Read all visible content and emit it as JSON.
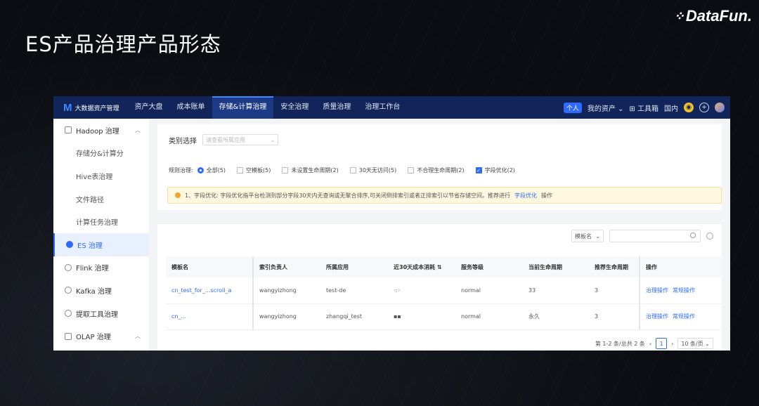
{
  "slide": {
    "title": "ES产品治理产品形态",
    "brand": "DataFun."
  },
  "topnav": {
    "app_name": "大数据资产管理",
    "items": [
      "资产大盘",
      "成本账单",
      "存储&计算治理",
      "安全治理",
      "质量治理",
      "治理工作台"
    ],
    "active_index": 2,
    "personal_badge": "个人",
    "my_assets": "我的资产",
    "toolbox": "工具箱",
    "region": "国内"
  },
  "sidebar": {
    "items": [
      {
        "label": "Hadoop 治理",
        "type": "group"
      },
      {
        "label": "存储分&计算分",
        "type": "sub"
      },
      {
        "label": "Hive表治理",
        "type": "sub"
      },
      {
        "label": "文件路径",
        "type": "sub"
      },
      {
        "label": "计算任务治理",
        "type": "sub"
      },
      {
        "label": "ES 治理",
        "type": "group",
        "active": true
      },
      {
        "label": "Flink 治理",
        "type": "group"
      },
      {
        "label": "Kafka 治理",
        "type": "group"
      },
      {
        "label": "提取工具治理",
        "type": "group"
      },
      {
        "label": "OLAP 治理",
        "type": "group"
      }
    ]
  },
  "filter": {
    "category_label": "类别选择",
    "category_placeholder": "请查看所属应用",
    "rule_label": "规则治理:",
    "options": [
      "全部(5)",
      "空模板(5)",
      "未设置生命周期(2)",
      "30天无访问(5)",
      "不合理生命周期(2)",
      "字段优化(2)"
    ],
    "notice_prefix": "1、字段优化: 字段优化指平台检测到部分字段30天内无查询或无聚合排序,可关闭倒排索引或者正排索引以节省存储空间。推荐进行",
    "notice_link": "字段优化",
    "notice_suffix": "操作"
  },
  "table": {
    "filter_select": "模板名",
    "columns": [
      "模板名",
      "索引负责人",
      "所属应用",
      "近30天成本消耗",
      "服务等级",
      "当前生命周期",
      "推荐生命周期",
      "操作"
    ],
    "rows": [
      {
        "name": "cn_test_for_...scroll_a",
        "owner": "wangyizhong",
        "app": "test-de",
        "cost": "·:◦",
        "level": "normal",
        "current": "33",
        "recommended": "3",
        "op1": "治理操作",
        "op2": "常规操作"
      },
      {
        "name": "cn_...",
        "owner": "wangyizhong",
        "app": "zhangqi_test",
        "cost": "▪▪",
        "level": "normal",
        "current": "永久",
        "recommended": "3",
        "op1": "治理操作",
        "op2": "常规操作"
      }
    ],
    "pager": {
      "summary": "第 1-2 条/总共 2 条",
      "current_page": "1",
      "page_size": "10 条/页"
    }
  }
}
